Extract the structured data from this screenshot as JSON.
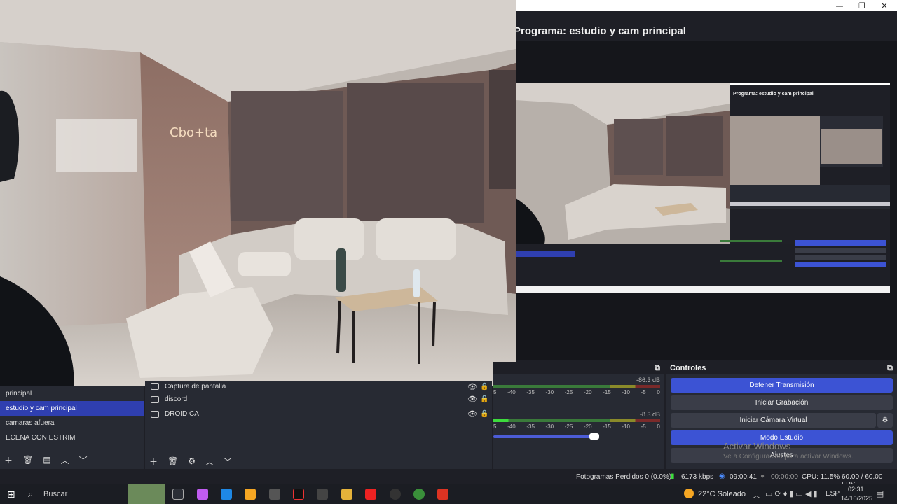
{
  "window": {
    "minimize": "—",
    "maximize": "❐",
    "close": "✕"
  },
  "program": {
    "title": "Programa: estudio y cam principal"
  },
  "nested": {
    "title": "Programa: estudio y cam principal"
  },
  "scenes": {
    "items": [
      "principal",
      "estudio y cam principal",
      "camaras afuera",
      "ECENA CON ESTRIM"
    ],
    "selected_index": 1
  },
  "sources": {
    "items": [
      "Captura de pantalla",
      "discord",
      "DROID CA"
    ]
  },
  "mixer": {
    "db1": "-86.3 dB",
    "db2": "-8.3 dB",
    "ticks": [
      "5",
      "-40",
      "-35",
      "-30",
      "-25",
      "-20",
      "-15",
      "-10",
      "-5",
      "0"
    ]
  },
  "controls": {
    "title": "Controles",
    "stop_stream": "Detener Transmisión",
    "start_rec": "Iniciar Grabación",
    "virtual_cam": "Iniciar Cámara Virtual",
    "studio_mode": "Modo Estudio",
    "settings": "Ajustes"
  },
  "status": {
    "dropped": "Fotogramas Perdidos 0 (0.0%)",
    "bitrate": "6173 kbps",
    "stream_time": "09:00:41",
    "rec_time": "00:00:00",
    "cpu": "CPU: 11.5%",
    "fps": "60.00 / 60.00 FPS"
  },
  "watermark": {
    "line1": "Activar Windows",
    "line2": "Ve a Configuración para activar Windows."
  },
  "taskbar": {
    "search": "Buscar",
    "weather": "22°C  Soleado",
    "lang": "ESP",
    "time": "02:31",
    "date": "14/10/2025"
  }
}
